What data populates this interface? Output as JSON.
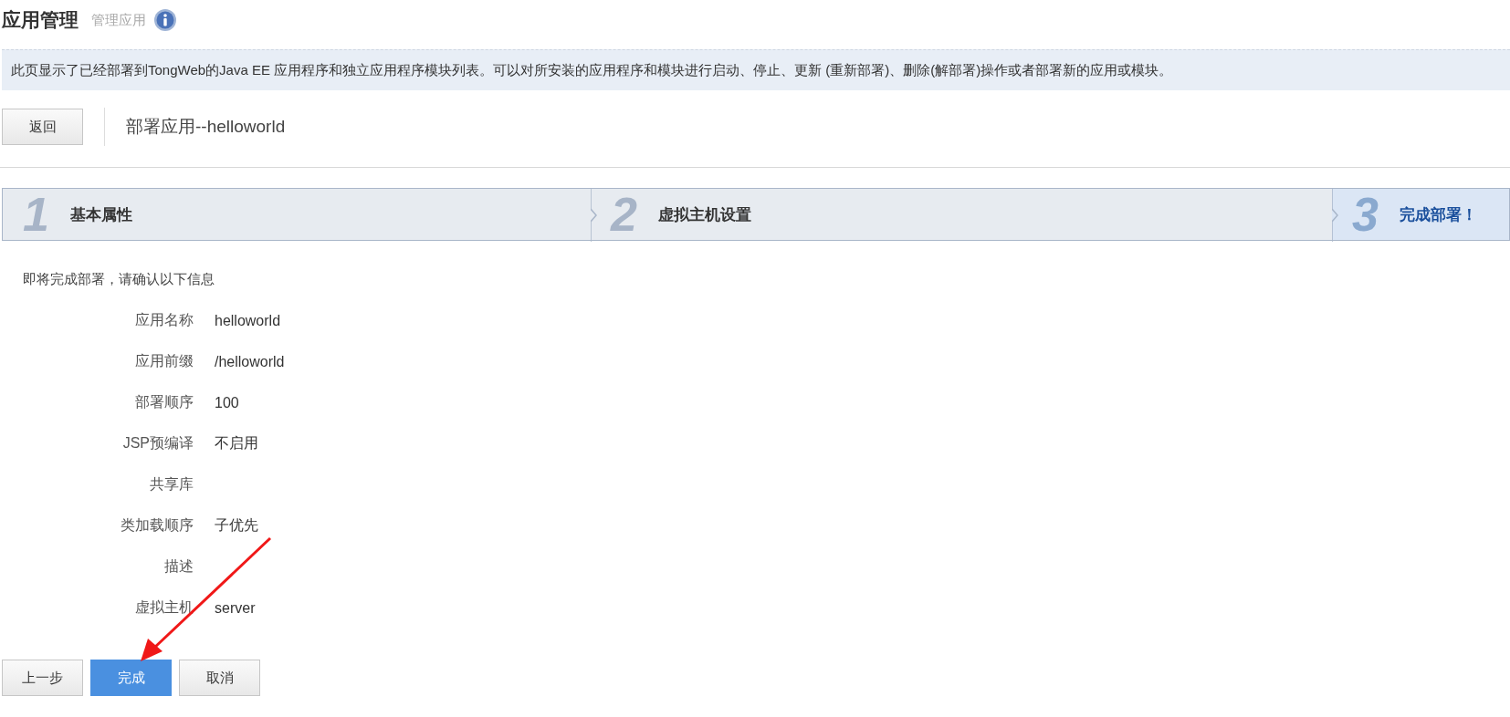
{
  "header": {
    "title": "应用管理",
    "subtitle": "管理应用"
  },
  "info_bar": "此页显示了已经部署到TongWeb的Java EE 应用程序和独立应用程序模块列表。可以对所安装的应用程序和模块进行启动、停止、更新 (重新部署)、删除(解部署)操作或者部署新的应用或模块。",
  "toolbar": {
    "back_button": "返回",
    "page_title": "部署应用--helloworld"
  },
  "steps": [
    {
      "number": "1",
      "label": "基本属性",
      "selected": false
    },
    {
      "number": "2",
      "label": "虚拟主机设置",
      "selected": false
    },
    {
      "number": "3",
      "label": "完成部署！",
      "selected": true
    }
  ],
  "summary": {
    "heading": "即将完成部署，请确认以下信息",
    "fields": [
      {
        "label": "应用名称",
        "value": "helloworld"
      },
      {
        "label": "应用前缀",
        "value": "/helloworld"
      },
      {
        "label": "部署顺序",
        "value": "100"
      },
      {
        "label": "JSP预编译",
        "value": "不启用"
      },
      {
        "label": "共享库"
      },
      {
        "label": "类加载顺序",
        "value": "子优先"
      },
      {
        "label": "描述"
      },
      {
        "label": "虚拟主机",
        "value": "server"
      }
    ]
  },
  "buttons": [
    {
      "label": "上一步",
      "kind": "normal"
    },
    {
      "label": "完成",
      "kind": "primary"
    },
    {
      "label": "取消",
      "kind": "normal"
    }
  ]
}
